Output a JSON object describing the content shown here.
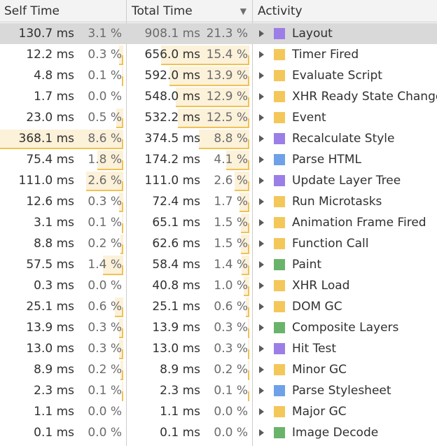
{
  "header": {
    "self_time": "Self Time",
    "total_time": "Total Time",
    "activity": "Activity",
    "sort_indicator": "▼"
  },
  "category_colors": {
    "rendering": "#9b7fe6",
    "scripting": "#f4c75a",
    "loading": "#6ea1e8",
    "painting": "#69b46a"
  },
  "bar_colors": {
    "fill": "#fcf1d9",
    "line": "#f0c253"
  },
  "selected_index": 0,
  "rows": [
    {
      "self_ms": "130.7 ms",
      "self_pct": "3.1 %",
      "total_ms": "908.1 ms",
      "total_pct": "21.3 %",
      "activity": "Layout",
      "category": "rendering",
      "self_frac": 0.031,
      "total_frac": 0.213
    },
    {
      "self_ms": "12.2 ms",
      "self_pct": "0.3 %",
      "total_ms": "656.0 ms",
      "total_pct": "15.4 %",
      "activity": "Timer Fired",
      "category": "scripting",
      "self_frac": 0.003,
      "total_frac": 0.154
    },
    {
      "self_ms": "4.8 ms",
      "self_pct": "0.1 %",
      "total_ms": "592.0 ms",
      "total_pct": "13.9 %",
      "activity": "Evaluate Script",
      "category": "scripting",
      "self_frac": 0.001,
      "total_frac": 0.139
    },
    {
      "self_ms": "1.7 ms",
      "self_pct": "0.0 %",
      "total_ms": "548.0 ms",
      "total_pct": "12.9 %",
      "activity": "XHR Ready State Change",
      "category": "scripting",
      "self_frac": 0.0,
      "total_frac": 0.129
    },
    {
      "self_ms": "23.0 ms",
      "self_pct": "0.5 %",
      "total_ms": "532.2 ms",
      "total_pct": "12.5 %",
      "activity": "Event",
      "category": "scripting",
      "self_frac": 0.005,
      "total_frac": 0.125
    },
    {
      "self_ms": "368.1 ms",
      "self_pct": "8.6 %",
      "total_ms": "374.5 ms",
      "total_pct": "8.8 %",
      "activity": "Recalculate Style",
      "category": "rendering",
      "self_frac": 0.086,
      "total_frac": 0.088
    },
    {
      "self_ms": "75.4 ms",
      "self_pct": "1.8 %",
      "total_ms": "174.2 ms",
      "total_pct": "4.1 %",
      "activity": "Parse HTML",
      "category": "loading",
      "self_frac": 0.018,
      "total_frac": 0.041
    },
    {
      "self_ms": "111.0 ms",
      "self_pct": "2.6 %",
      "total_ms": "111.0 ms",
      "total_pct": "2.6 %",
      "activity": "Update Layer Tree",
      "category": "rendering",
      "self_frac": 0.026,
      "total_frac": 0.026
    },
    {
      "self_ms": "12.6 ms",
      "self_pct": "0.3 %",
      "total_ms": "72.4 ms",
      "total_pct": "1.7 %",
      "activity": "Run Microtasks",
      "category": "scripting",
      "self_frac": 0.003,
      "total_frac": 0.017
    },
    {
      "self_ms": "3.1 ms",
      "self_pct": "0.1 %",
      "total_ms": "65.1 ms",
      "total_pct": "1.5 %",
      "activity": "Animation Frame Fired",
      "category": "scripting",
      "self_frac": 0.001,
      "total_frac": 0.015
    },
    {
      "self_ms": "8.8 ms",
      "self_pct": "0.2 %",
      "total_ms": "62.6 ms",
      "total_pct": "1.5 %",
      "activity": "Function Call",
      "category": "scripting",
      "self_frac": 0.002,
      "total_frac": 0.015
    },
    {
      "self_ms": "57.5 ms",
      "self_pct": "1.4 %",
      "total_ms": "58.4 ms",
      "total_pct": "1.4 %",
      "activity": "Paint",
      "category": "painting",
      "self_frac": 0.014,
      "total_frac": 0.014
    },
    {
      "self_ms": "0.3 ms",
      "self_pct": "0.0 %",
      "total_ms": "40.8 ms",
      "total_pct": "1.0 %",
      "activity": "XHR Load",
      "category": "scripting",
      "self_frac": 0.0,
      "total_frac": 0.01
    },
    {
      "self_ms": "25.1 ms",
      "self_pct": "0.6 %",
      "total_ms": "25.1 ms",
      "total_pct": "0.6 %",
      "activity": "DOM GC",
      "category": "scripting",
      "self_frac": 0.006,
      "total_frac": 0.006
    },
    {
      "self_ms": "13.9 ms",
      "self_pct": "0.3 %",
      "total_ms": "13.9 ms",
      "total_pct": "0.3 %",
      "activity": "Composite Layers",
      "category": "painting",
      "self_frac": 0.003,
      "total_frac": 0.003
    },
    {
      "self_ms": "13.0 ms",
      "self_pct": "0.3 %",
      "total_ms": "13.0 ms",
      "total_pct": "0.3 %",
      "activity": "Hit Test",
      "category": "rendering",
      "self_frac": 0.003,
      "total_frac": 0.003
    },
    {
      "self_ms": "8.9 ms",
      "self_pct": "0.2 %",
      "total_ms": "8.9 ms",
      "total_pct": "0.2 %",
      "activity": "Minor GC",
      "category": "scripting",
      "self_frac": 0.002,
      "total_frac": 0.002
    },
    {
      "self_ms": "2.3 ms",
      "self_pct": "0.1 %",
      "total_ms": "2.3 ms",
      "total_pct": "0.1 %",
      "activity": "Parse Stylesheet",
      "category": "loading",
      "self_frac": 0.001,
      "total_frac": 0.001
    },
    {
      "self_ms": "1.1 ms",
      "self_pct": "0.0 %",
      "total_ms": "1.1 ms",
      "total_pct": "0.0 %",
      "activity": "Major GC",
      "category": "scripting",
      "self_frac": 0.0,
      "total_frac": 0.0
    },
    {
      "self_ms": "0.1 ms",
      "self_pct": "0.0 %",
      "total_ms": "0.1 ms",
      "total_pct": "0.0 %",
      "activity": "Image Decode",
      "category": "painting",
      "self_frac": 0.0,
      "total_frac": 0.0
    }
  ]
}
